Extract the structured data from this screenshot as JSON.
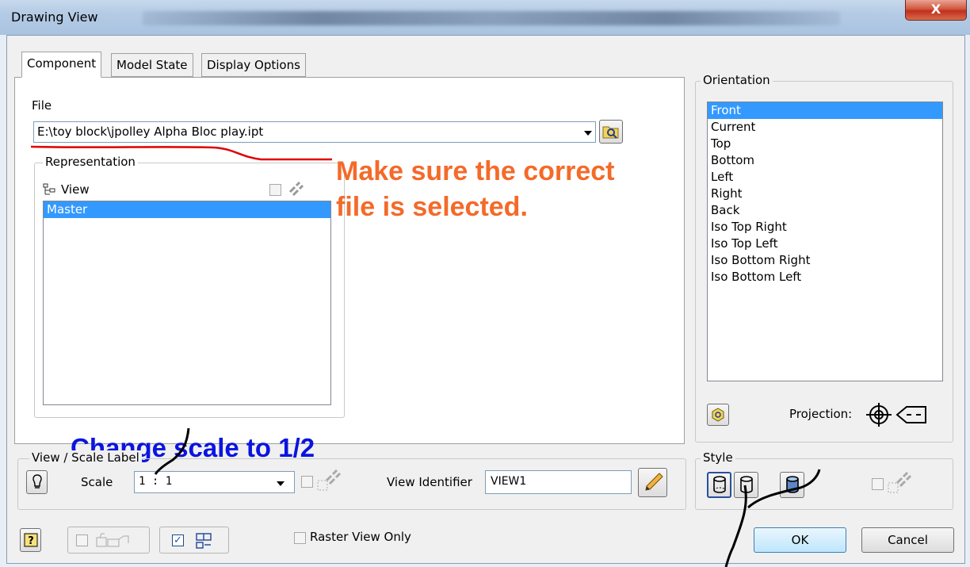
{
  "window": {
    "title": "Drawing View",
    "close_label": "X"
  },
  "tabs": [
    {
      "label": "Component",
      "active": true
    },
    {
      "label": "Model State",
      "active": false
    },
    {
      "label": "Display Options",
      "active": false
    }
  ],
  "file": {
    "label": "File",
    "value": "E:\\toy block\\jpolley Alpha Bloc play.ipt"
  },
  "representation": {
    "label": "Representation",
    "view_label": "View",
    "items": [
      {
        "label": "Master",
        "selected": true
      }
    ]
  },
  "orientation": {
    "label": "Orientation",
    "items": [
      "Front",
      "Current",
      "Top",
      "Bottom",
      "Left",
      "Right",
      "Back",
      "Iso Top Right",
      "Iso Top Left",
      "Iso Bottom Right",
      "Iso Bottom Left"
    ],
    "selected": "Front",
    "projection_label": "Projection:"
  },
  "view_scale": {
    "label": "View / Scale Label",
    "scale_label": "Scale",
    "scale_value": "1 : 1",
    "identifier_label": "View Identifier",
    "identifier_value": "VIEW1"
  },
  "style": {
    "label": "Style"
  },
  "bottom": {
    "raster_label": "Raster View Only",
    "ok_label": "OK",
    "cancel_label": "Cancel"
  },
  "annotations": {
    "file_note_line1": "Make sure the correct",
    "file_note_line2": "file is selected.",
    "scale_note": "Change scale to 1/2"
  },
  "colors": {
    "annotation_orange": "#f46a29",
    "annotation_blue": "#0a14e0",
    "selection": "#3399ff",
    "underline_red": "#e00000"
  }
}
